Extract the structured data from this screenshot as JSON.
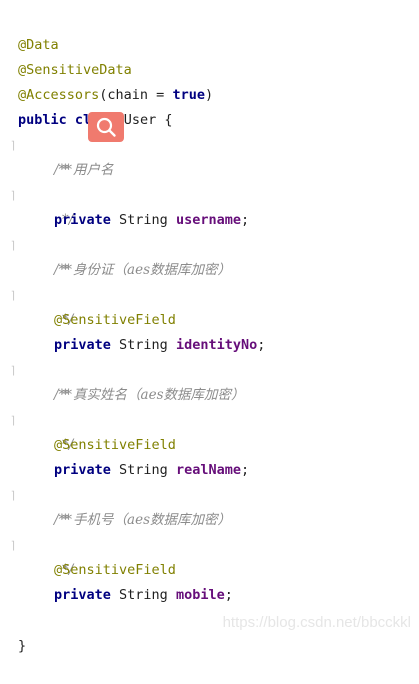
{
  "code": {
    "annotations": {
      "data": "@Data",
      "sensitive_data": "@SensitiveData",
      "accessors_prefix": "@Accessors",
      "accessors_args_open": "(chain = ",
      "accessors_true": "true",
      "accessors_close": ")",
      "sensitive_field": "@SensitiveField"
    },
    "class_decl": {
      "public": "public",
      "class": "class",
      "name": " User {"
    },
    "comments": {
      "open": "/**",
      "close": "*/",
      "username": "* 用户名",
      "identity": "* 身份证（aes数据库加密）",
      "realname": "* 真实姓名（aes数据库加密）",
      "mobile": "* 手机号（aes数据库加密）"
    },
    "fields": {
      "private": "private",
      "type": " String ",
      "username": "username",
      "identityNo": "identityNo",
      "realName": "realName",
      "mobile": "mobile",
      "semicolon": ";"
    },
    "closing_brace": "}"
  },
  "gutter_mark": "⌉",
  "search_icon": "search-icon",
  "watermark": "https://blog.csdn.net/bbcckkl"
}
